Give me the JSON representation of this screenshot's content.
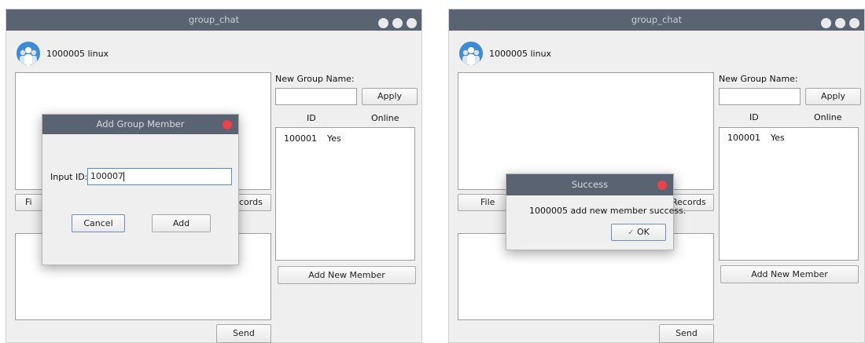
{
  "window_title": "group_chat",
  "user_label": "1000005  linux",
  "group_name_label": "New Group Name:",
  "apply_label": "Apply",
  "columns": [
    "ID",
    "Online"
  ],
  "members": [
    {
      "id": "100001",
      "online": "Yes"
    }
  ],
  "file_label": "File",
  "file_label_partial": "Fi",
  "records_label_partial": "cords",
  "records_label_partial_right": "Records",
  "add_member_label": "Add New Member",
  "send_label": "Send",
  "add_dialog": {
    "title": "Add Group Member",
    "input_label": "Input ID:",
    "input_value": "100007",
    "cancel_label": "Cancel",
    "add_label": "Add"
  },
  "success_dialog": {
    "title": "Success",
    "message": "1000005 add new member success.",
    "ok_label": "OK",
    "ok_icon": "✓"
  },
  "colors": {
    "titlebar": "#5a6372",
    "close_button": "#e8434b",
    "focus_border": "#4a90d9"
  }
}
